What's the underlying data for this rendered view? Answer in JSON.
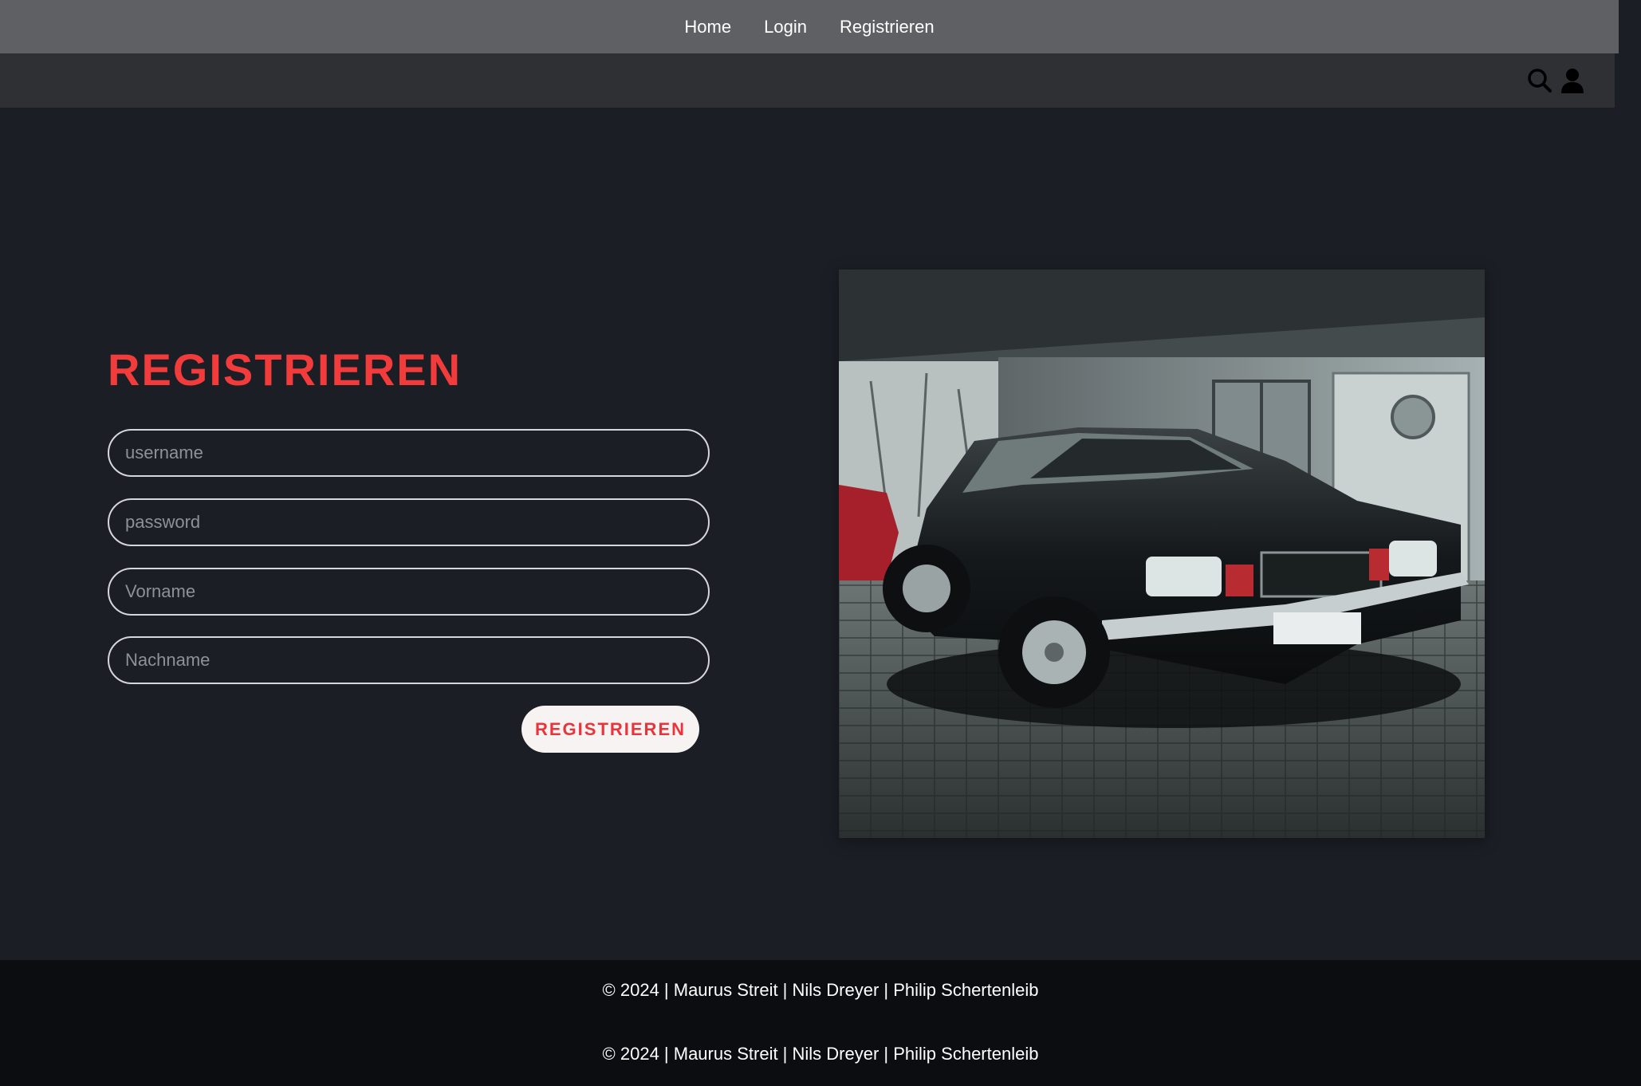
{
  "nav": {
    "items": [
      {
        "label": "Home"
      },
      {
        "label": "Login"
      },
      {
        "label": "Registrieren"
      }
    ]
  },
  "header": {
    "icons": [
      "search-icon",
      "user-icon"
    ]
  },
  "form": {
    "title": "REGISTRIEREN",
    "fields": [
      {
        "placeholder": "username",
        "value": ""
      },
      {
        "placeholder": "password",
        "value": ""
      },
      {
        "placeholder": "Vorname",
        "value": ""
      },
      {
        "placeholder": "Nachname",
        "value": ""
      }
    ],
    "submit_label": "REGISTRIEREN"
  },
  "footer": {
    "lines": [
      "© 2024 | Maurus Streit | Nils Dreyer | Philip Schertenleib",
      "© 2024 | Maurus Streit | Nils Dreyer | Philip Schertenleib"
    ]
  },
  "colors": {
    "accent": "#f23b3b",
    "page_background": "#1b1e25",
    "top_nav": "#5f6063",
    "sub_bar": "#2f3033",
    "footer": "#0b0d10"
  }
}
